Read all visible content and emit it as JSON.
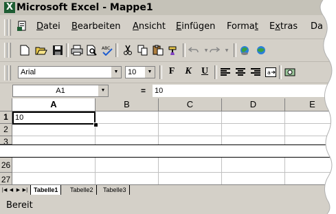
{
  "window": {
    "title": "Microsoft Excel - Mappe1",
    "app_icon": "excel-x-icon"
  },
  "menu": {
    "items": [
      {
        "label": "Datei",
        "accel": "D"
      },
      {
        "label": "Bearbeiten",
        "accel": "B"
      },
      {
        "label": "Ansicht",
        "accel": "A"
      },
      {
        "label": "Einfügen",
        "accel": "E"
      },
      {
        "label": "Format",
        "accel": "t"
      },
      {
        "label": "Extras",
        "accel": "x"
      },
      {
        "label": "Da",
        "accel": ""
      }
    ]
  },
  "standard_toolbar": {
    "buttons": [
      "new-icon",
      "open-icon",
      "save-icon",
      "print-icon",
      "print-preview-icon",
      "spelling-icon",
      "cut-icon",
      "copy-icon",
      "paste-icon",
      "format-painter-icon",
      "undo-icon",
      "redo-icon",
      "hyperlink-icon",
      "web-toolbar-icon"
    ]
  },
  "format_toolbar": {
    "font": "Arial",
    "size": "10",
    "bold_label": "F",
    "italic_label": "K",
    "underline_label": "U",
    "buttons": [
      "align-left-icon",
      "align-center-icon",
      "align-right-icon",
      "merge-center-icon",
      "currency-icon"
    ]
  },
  "formula_bar": {
    "name_box": "A1",
    "equals": "=",
    "value": "10"
  },
  "sheet": {
    "columns": [
      "A",
      "B",
      "C",
      "D",
      "E"
    ],
    "rows_top": [
      "1",
      "2",
      "3"
    ],
    "rows_bottom": [
      "26",
      "27"
    ],
    "cells": {
      "A1": "10"
    },
    "active_cell": "A1"
  },
  "tabs": {
    "sheets": [
      "Tabelle1",
      "Tabelle2",
      "Tabelle3"
    ],
    "active": "Tabelle1"
  },
  "status": {
    "text": "Bereit"
  },
  "colors": {
    "chrome": "#d4d0c8",
    "title_bar": "#c5c2b8",
    "excel_green": "#1e5d33",
    "gridline": "#c0c0c0"
  }
}
